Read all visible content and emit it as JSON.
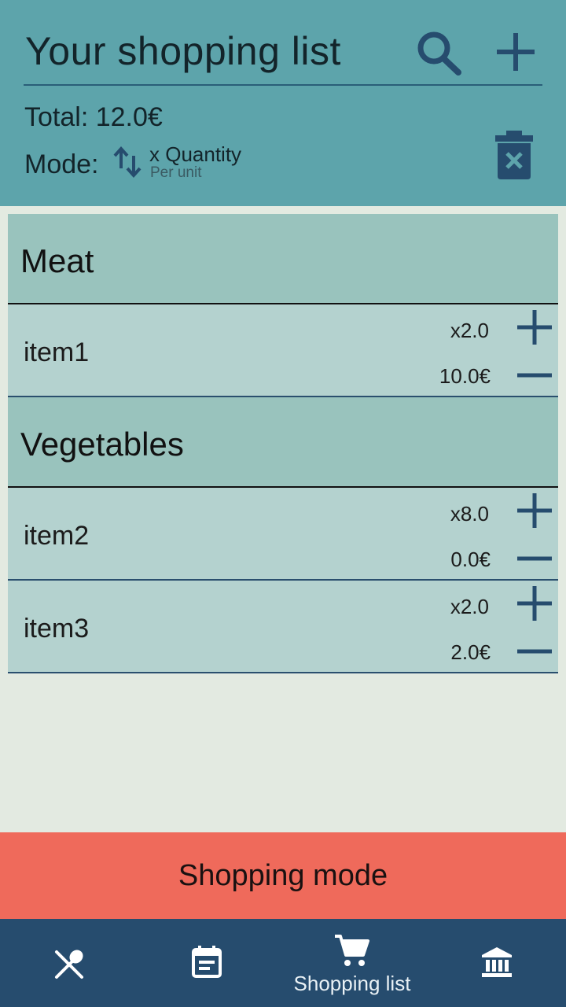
{
  "header": {
    "title": "Your shopping list",
    "total": "Total: 12.0€",
    "mode_label": "Mode:",
    "mode_value": "x Quantity",
    "mode_sub": "Per unit",
    "icons": [
      "search-icon",
      "plus-icon",
      "swap-vertical-icon",
      "delete-icon"
    ]
  },
  "categories": [
    {
      "name": "Meat",
      "items": [
        {
          "name": "item1",
          "quantity": "x2.0",
          "price": "10.0€"
        }
      ]
    },
    {
      "name": "Vegetables",
      "items": [
        {
          "name": "item2",
          "quantity": "x8.0",
          "price": "0.0€"
        },
        {
          "name": "item3",
          "quantity": "x2.0",
          "price": "2.0€"
        }
      ]
    }
  ],
  "shopping_mode": {
    "label": "Shopping mode"
  },
  "bottom_nav": {
    "items": [
      {
        "icon": "utensils-icon",
        "label": ""
      },
      {
        "icon": "calendar-icon",
        "label": ""
      },
      {
        "icon": "cart-icon",
        "label": "Shopping list",
        "active": true
      },
      {
        "icon": "bank-icon",
        "label": ""
      }
    ]
  },
  "colors": {
    "header_bg": "#5da4ab",
    "category_bg": "#99c3bd",
    "item_bg": "#b4d2cf",
    "page_bg": "#e3eae1",
    "accent_dark": "#264c6e",
    "shopping_mode_bg": "#ef6a5b"
  }
}
